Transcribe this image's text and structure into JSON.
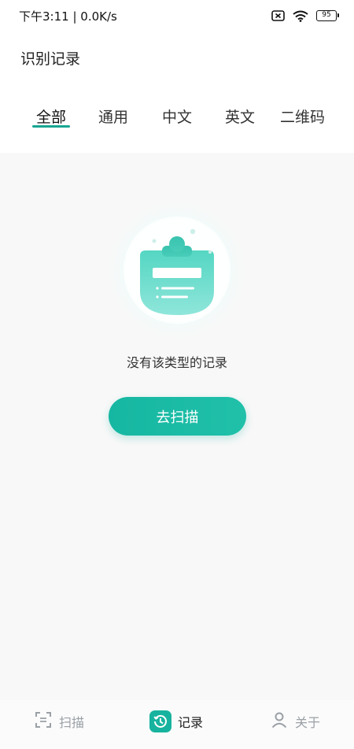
{
  "status_bar": {
    "time_speed": "下午3:11 | 0.0K/s",
    "battery": "95",
    "icons": [
      "sim-missing-icon",
      "wifi-icon",
      "battery-icon"
    ]
  },
  "header": {
    "title": "识别记录"
  },
  "tabs": [
    {
      "label": "全部",
      "active": true
    },
    {
      "label": "通用",
      "active": false
    },
    {
      "label": "中文",
      "active": false
    },
    {
      "label": "英文",
      "active": false
    },
    {
      "label": "二维码",
      "active": false
    }
  ],
  "empty_state": {
    "icon": "empty-clipboard-icon",
    "message": "没有该类型的记录",
    "button_label": "去扫描"
  },
  "bottom_nav": [
    {
      "label": "扫描",
      "icon": "scan-icon",
      "active": false
    },
    {
      "label": "记录",
      "icon": "history-icon",
      "active": true
    },
    {
      "label": "关于",
      "icon": "person-icon",
      "active": false
    }
  ],
  "colors": {
    "accent": "#17a592",
    "button": "#18b7a2",
    "inactive_nav": "#9aa0a6"
  }
}
